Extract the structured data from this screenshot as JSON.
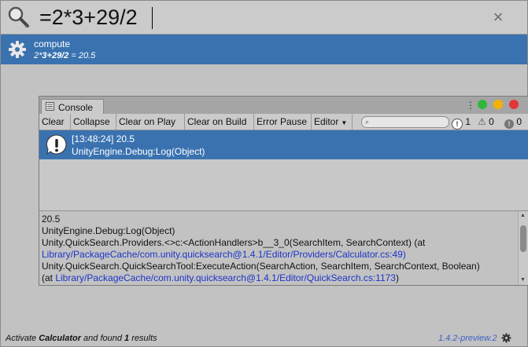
{
  "search": {
    "query": "=2*3+29/2",
    "clear_icon": "close-icon"
  },
  "result": {
    "name": "compute",
    "desc_prefix": "2*",
    "desc_bold": "3+29/2",
    "desc_suffix": " = 20.5"
  },
  "console": {
    "tab_label": "Console",
    "toolbar": {
      "clear": "Clear",
      "collapse": "Collapse",
      "clear_on_play": "Clear on Play",
      "clear_on_build": "Clear on Build",
      "error_pause": "Error Pause",
      "editor": "Editor"
    },
    "counts": {
      "info": "1",
      "warning": "0",
      "error": "0"
    },
    "entry": {
      "line1": "[13:48:24] 20.5",
      "line2": "UnityEngine.Debug:Log(Object)"
    },
    "detail": {
      "l1": "20.5",
      "l2": "UnityEngine.Debug:Log(Object)",
      "l3": "Unity.QuickSearch.Providers.<>c:<ActionHandlers>b__3_0(SearchItem, SearchContext) (at",
      "l4": "Library/PackageCache/com.unity.quicksearch@1.4.1/Editor/Providers/Calculator.cs:49)",
      "l5": "Unity.QuickSearch.QuickSearchTool:ExecuteAction(SearchAction, SearchItem, SearchContext, Boolean)",
      "l6_prefix": "(at ",
      "l6_link": "Library/PackageCache/com.unity.quicksearch@1.4.1/Editor/QuickSearch.cs:1173",
      "l6_suffix": ")"
    },
    "window_dot_colors": [
      "#2fb83c",
      "#f2b300",
      "#e2373a"
    ]
  },
  "status": {
    "prefix": "Activate ",
    "provider": "Calculator",
    "middle": " and found ",
    "count": "1",
    "suffix": " results",
    "version": "1.4.2-preview.2"
  },
  "colors": {
    "selection": "#3a72b0",
    "link": "#1b35c9",
    "version": "#3d62c5"
  }
}
